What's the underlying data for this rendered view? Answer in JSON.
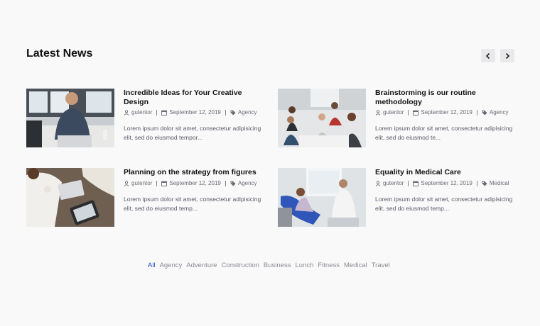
{
  "section": {
    "title": "Latest News"
  },
  "nav": {
    "prev_icon": "chevron-left-icon",
    "next_icon": "chevron-right-icon"
  },
  "posts": [
    {
      "title": "Incredible Ideas for Your Creative Design",
      "author": "gutentor",
      "date": "September 12, 2019",
      "category": "Agency",
      "excerpt": "Lorem ipsum dolor sit amet, consectetur adipisicing elit, sed do eiusmod tempor..."
    },
    {
      "title": "Brainstorming is our routine methodology",
      "author": "gutentor",
      "date": "September 12, 2019",
      "category": "Agency",
      "excerpt": "Lorem ipsum dolor sit amet, consectetur adipisicing elit, sed do eiusmod te..."
    },
    {
      "title": "Planning on the strategy from figures",
      "author": "gutentor",
      "date": "September 12, 2019",
      "category": "Agency",
      "excerpt": "Lorem ipsum dolor sit amet, consectetur adipisicing elit, sed do eiusmod temp..."
    },
    {
      "title": "Equality in Medical Care",
      "author": "gutentor",
      "date": "September 12, 2019",
      "category": "Medical",
      "excerpt": "Lorem ipsum dolor sit amet, consectetur adipisicing elit, sed do eiusmod temp..."
    }
  ],
  "filters": [
    "All",
    "Agency",
    "Adventure",
    "Construction",
    "Business",
    "Lunch",
    "Fitness",
    "Medical",
    "Travel"
  ],
  "active_filter": "All",
  "colors": {
    "accent": "#2b4fc5",
    "text": "#111111",
    "meta": "#6a6a75"
  }
}
